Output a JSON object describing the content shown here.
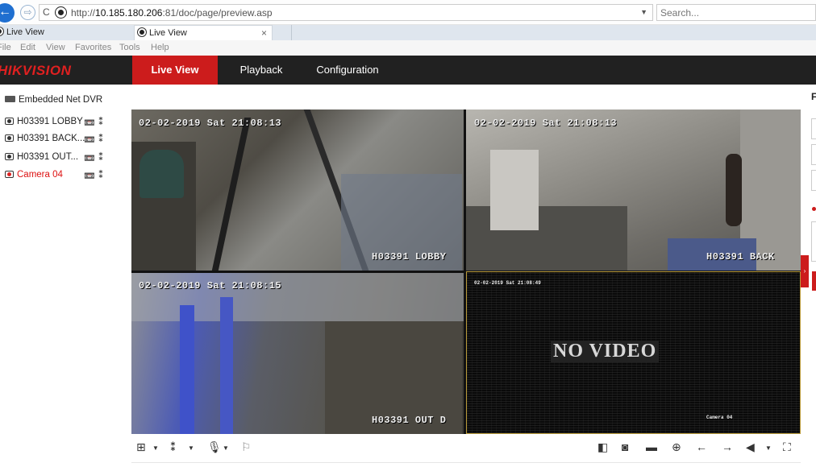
{
  "browser": {
    "url_prefix": "http://",
    "url_host": "10.185.180.206",
    "url_rest": ":81/doc/page/preview.asp",
    "search_placeholder": "Search...",
    "tabs": [
      {
        "label": "Live View"
      },
      {
        "label": "Live View",
        "close": "×"
      }
    ],
    "menu": [
      "File",
      "Edit",
      "View",
      "Favorites",
      "Tools",
      "Help"
    ]
  },
  "app": {
    "logo": "HIKVISION",
    "nav": [
      {
        "label": "Live View",
        "active": true
      },
      {
        "label": "Playback",
        "active": false
      },
      {
        "label": "Configuration",
        "active": false
      }
    ]
  },
  "device_tree": {
    "root": "Embedded Net DVR",
    "cameras": [
      {
        "label": "H03391 LOBBY",
        "recording": true
      },
      {
        "label": "H03391 BACK...",
        "recording": true
      },
      {
        "label": "H03391 OUT...",
        "recording": true
      },
      {
        "label": "Camera 04",
        "recording": false
      }
    ]
  },
  "video": {
    "tiles": [
      {
        "timestamp": "02-02-2019 Sat 21:08:13",
        "name": "H03391 LOBBY"
      },
      {
        "timestamp": "02-02-2019 Sat 21:08:13",
        "name": "H03391 BACK"
      },
      {
        "timestamp": "02-02-2019 Sat 21:08:15",
        "name": "H03391 OUT D"
      },
      {
        "timestamp": "02-02-2019 Sat 21:08:49",
        "name": "Camera 04",
        "message": "NO VIDEO"
      }
    ]
  },
  "right_panel": {
    "title": "F"
  }
}
